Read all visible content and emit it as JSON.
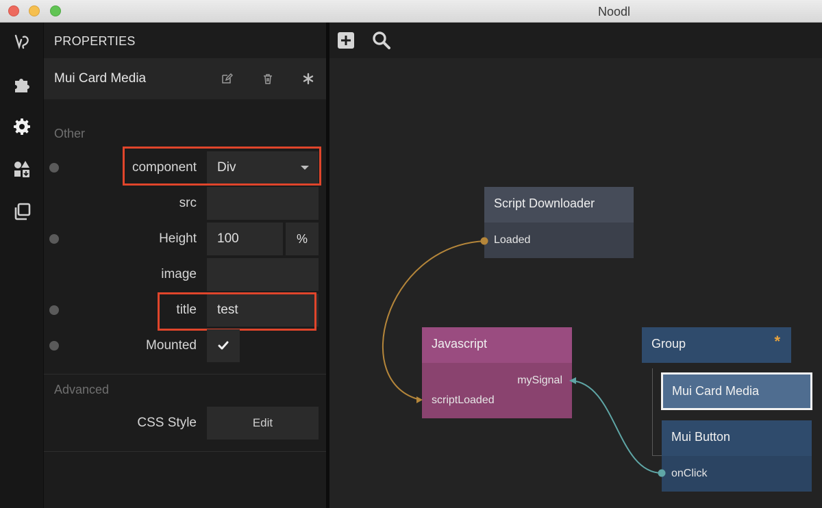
{
  "window": {
    "title": "Noodl"
  },
  "panel": {
    "header": "PROPERTIES",
    "node_name": "Mui Card Media",
    "sections": {
      "other": "Other",
      "advanced": "Advanced"
    },
    "props": {
      "component": {
        "label": "component",
        "value": "Div"
      },
      "src": {
        "label": "src",
        "value": ""
      },
      "height": {
        "label": "Height",
        "value": "100",
        "unit": "%"
      },
      "image": {
        "label": "image",
        "value": ""
      },
      "title": {
        "label": "title",
        "value": "test"
      },
      "mounted": {
        "label": "Mounted",
        "checked": true
      },
      "css_style": {
        "label": "CSS Style",
        "button": "Edit"
      }
    }
  },
  "canvas": {
    "nodes": {
      "script_downloader": {
        "title": "Script Downloader",
        "port": "Loaded"
      },
      "javascript": {
        "title": "Javascript",
        "port_out": "mySignal",
        "port_in": "scriptLoaded"
      },
      "group": {
        "title": "Group",
        "marker": "*"
      },
      "mui_card_media": {
        "title": "Mui Card Media"
      },
      "mui_button": {
        "title": "Mui Button",
        "port": "onClick"
      }
    }
  },
  "colors": {
    "highlight": "#e0452b",
    "script_node": "#3f4552",
    "js_node": "#8e4576",
    "visual_node": "#2e4a6b",
    "wire_orange": "#b5863a",
    "wire_teal": "#5fa6a6"
  },
  "icons": [
    "noodl-logo-icon",
    "puzzle-icon",
    "gear-icon",
    "components-icon",
    "copy-icon",
    "edit-icon",
    "trash-icon",
    "asterisk-icon",
    "plus-icon",
    "search-icon",
    "check-icon",
    "dropdown-caret-icon"
  ]
}
